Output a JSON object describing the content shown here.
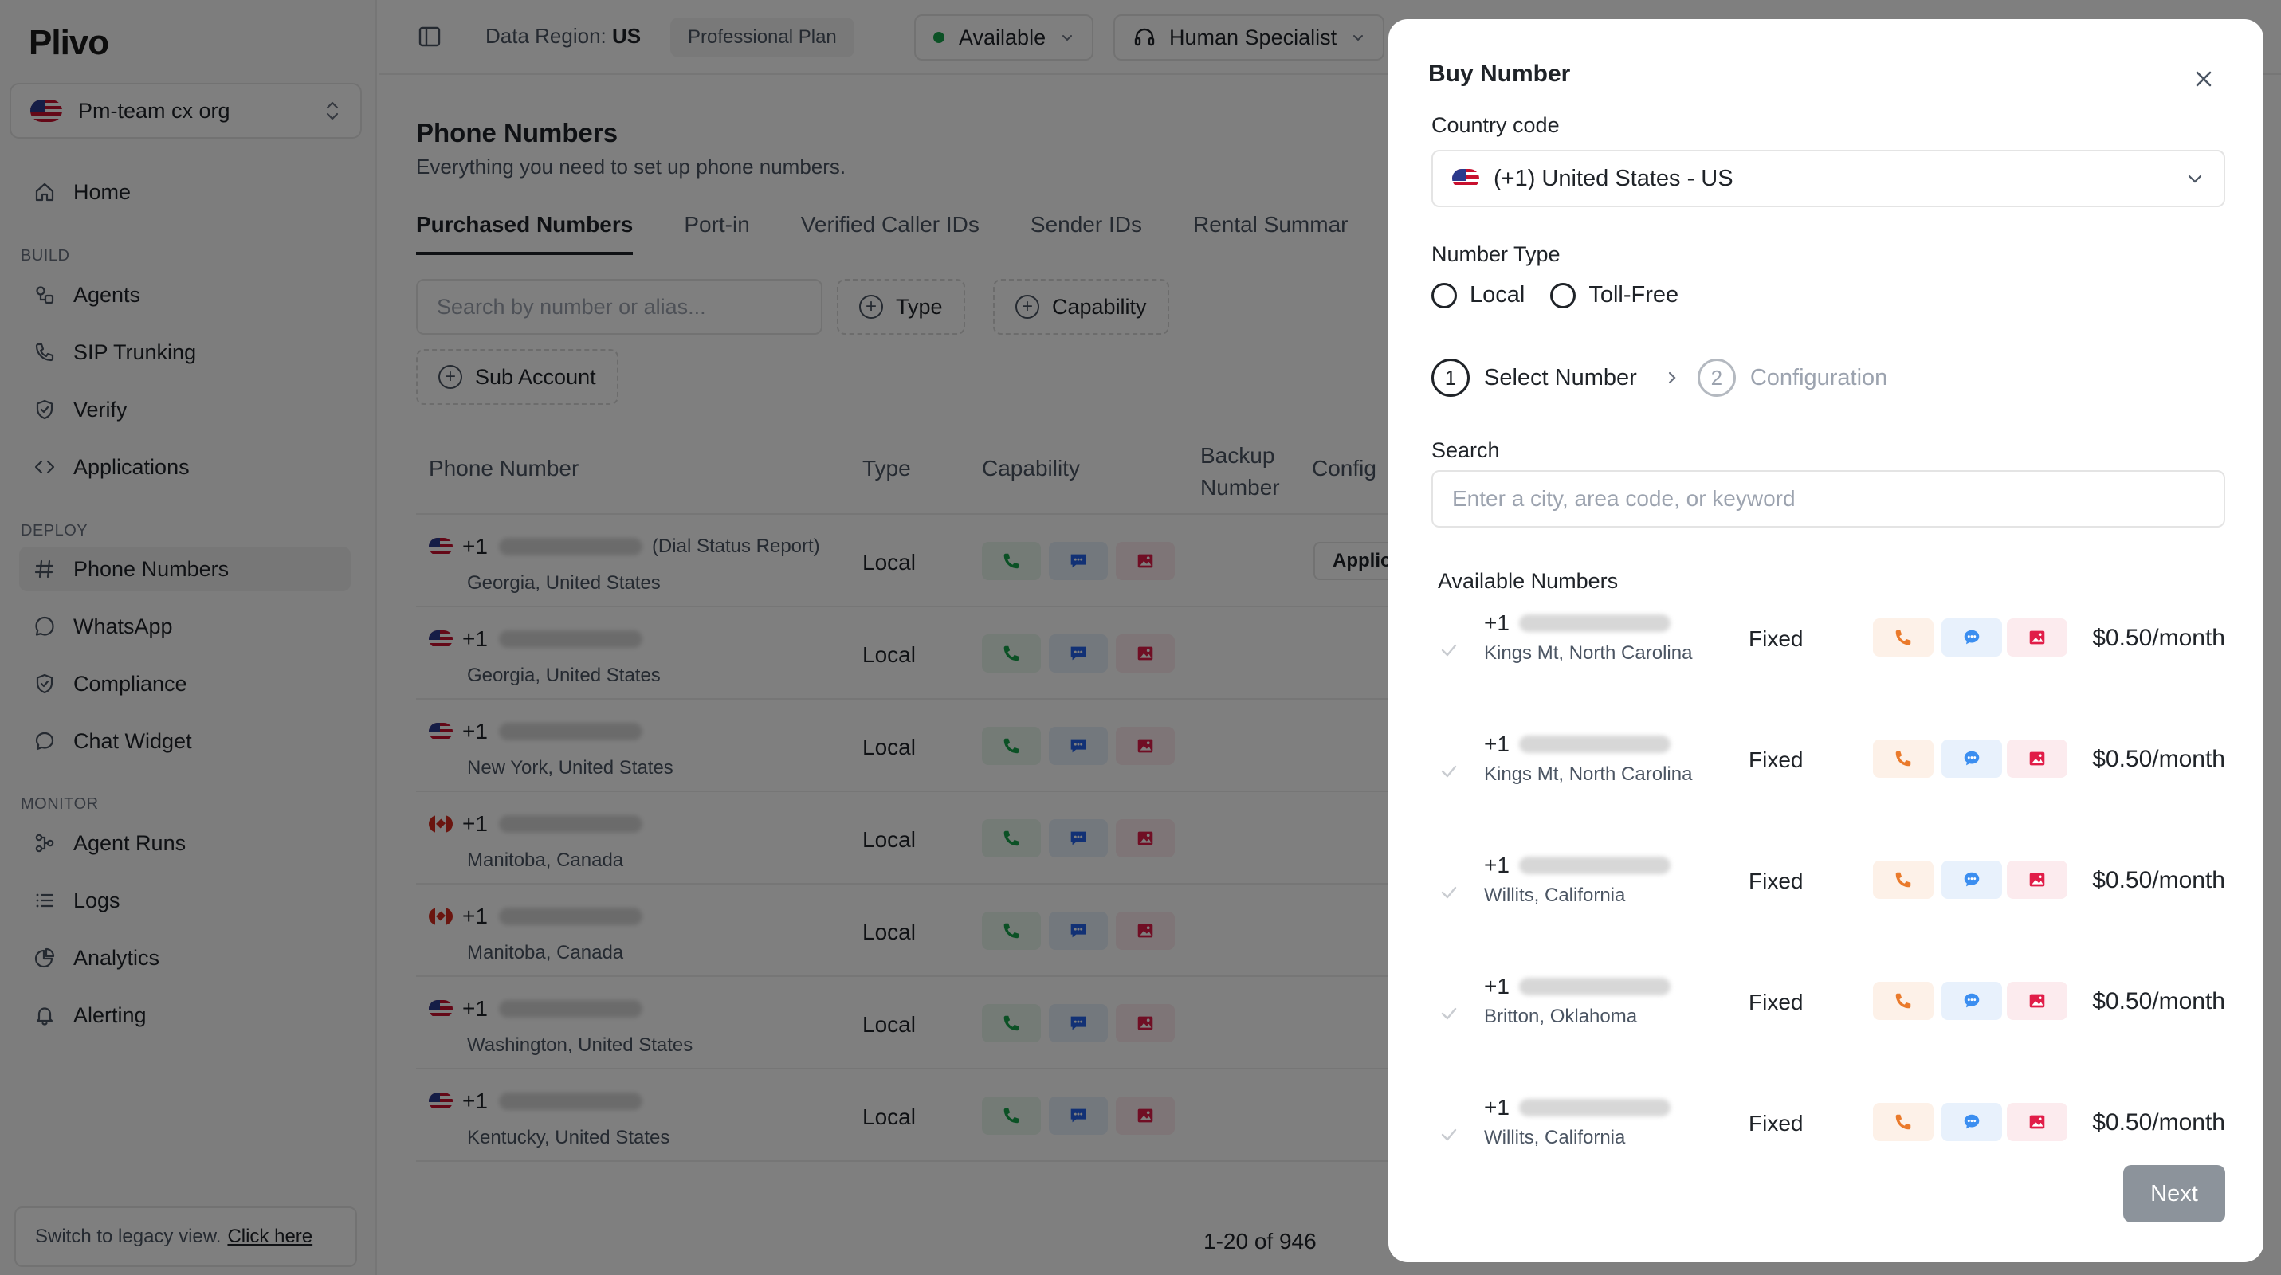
{
  "brand": {
    "logo": "Plivo"
  },
  "org": {
    "name": "Pm-team cx org"
  },
  "nav": {
    "home": "Home",
    "sections": {
      "build": "BUILD",
      "deploy": "DEPLOY",
      "monitor": "MONITOR"
    },
    "build_items": [
      "Agents",
      "SIP Trunking",
      "Verify",
      "Applications"
    ],
    "deploy_items": [
      "Phone Numbers",
      "WhatsApp",
      "Compliance",
      "Chat Widget"
    ],
    "monitor_items": [
      "Agent Runs",
      "Logs",
      "Analytics",
      "Alerting"
    ]
  },
  "legacy": {
    "text": "Switch to legacy view.",
    "link": "Click here"
  },
  "topbar": {
    "region_label": "Data Region:",
    "region_value": "US",
    "plan": "Professional Plan",
    "status": "Available",
    "role": "Human Specialist"
  },
  "page": {
    "title": "Phone Numbers",
    "subtitle": "Everything you need to set up phone numbers.",
    "tabs": [
      "Purchased Numbers",
      "Port-in",
      "Verified Caller IDs",
      "Sender IDs",
      "Rental Summar"
    ],
    "search_placeholder": "Search by number or alias...",
    "filters": [
      "Type",
      "Capability",
      "Sub Account"
    ]
  },
  "table": {
    "headers": {
      "phone": "Phone Number",
      "type": "Type",
      "capability": "Capability",
      "backup_line1": "Backup",
      "backup_line2": "Number",
      "config": "Config"
    },
    "rows": [
      {
        "prefix": "+1",
        "alias": "(Dial Status Report)",
        "location": "Georgia, United States",
        "type": "Local",
        "config": "Applic"
      },
      {
        "prefix": "+1",
        "alias": "",
        "location": "Georgia, United States",
        "type": "Local",
        "config": ""
      },
      {
        "prefix": "+1",
        "alias": "",
        "location": "New York, United States",
        "type": "Local",
        "config": ""
      },
      {
        "prefix": "+1",
        "alias": "",
        "location": "Manitoba, Canada",
        "type": "Local",
        "config": ""
      },
      {
        "prefix": "+1",
        "alias": "",
        "location": "Manitoba, Canada",
        "type": "Local",
        "config": ""
      },
      {
        "prefix": "+1",
        "alias": "",
        "location": "Washington, United States",
        "type": "Local",
        "config": ""
      },
      {
        "prefix": "+1",
        "alias": "",
        "location": "Kentucky, United States",
        "type": "Local",
        "config": ""
      }
    ],
    "pagination": "1-20 of 946"
  },
  "modal": {
    "title": "Buy Number",
    "country_label": "Country code",
    "country_value": "(+1) United States - US",
    "number_type_label": "Number Type",
    "number_types": [
      "Local",
      "Toll-Free"
    ],
    "steps": [
      {
        "num": "1",
        "label": "Select Number"
      },
      {
        "num": "2",
        "label": "Configuration"
      }
    ],
    "search_label": "Search",
    "search_placeholder": "Enter a city, area code, or keyword",
    "available_title": "Available Numbers",
    "numbers": [
      {
        "prefix": "+1",
        "location": "Kings Mt, North Carolina",
        "type": "Fixed",
        "price": "$0.50/month"
      },
      {
        "prefix": "+1",
        "location": "Kings Mt, North Carolina",
        "type": "Fixed",
        "price": "$0.50/month"
      },
      {
        "prefix": "+1",
        "location": "Willits, California",
        "type": "Fixed",
        "price": "$0.50/month"
      },
      {
        "prefix": "+1",
        "location": "Britton, Oklahoma",
        "type": "Fixed",
        "price": "$0.50/month"
      },
      {
        "prefix": "+1",
        "location": "Willits, California",
        "type": "Fixed",
        "price": "$0.50/month"
      }
    ],
    "next_label": "Next"
  },
  "colors": {
    "voice": "#16a34a",
    "sms": "#2563eb",
    "mms": "#e11d48",
    "modal_voice": "#ea7a2b",
    "modal_sms": "#3b8ef0",
    "next_disabled": "#8c939b"
  },
  "icons": {
    "voice": "phone-icon",
    "sms": "chat-icon",
    "mms": "image-icon"
  }
}
